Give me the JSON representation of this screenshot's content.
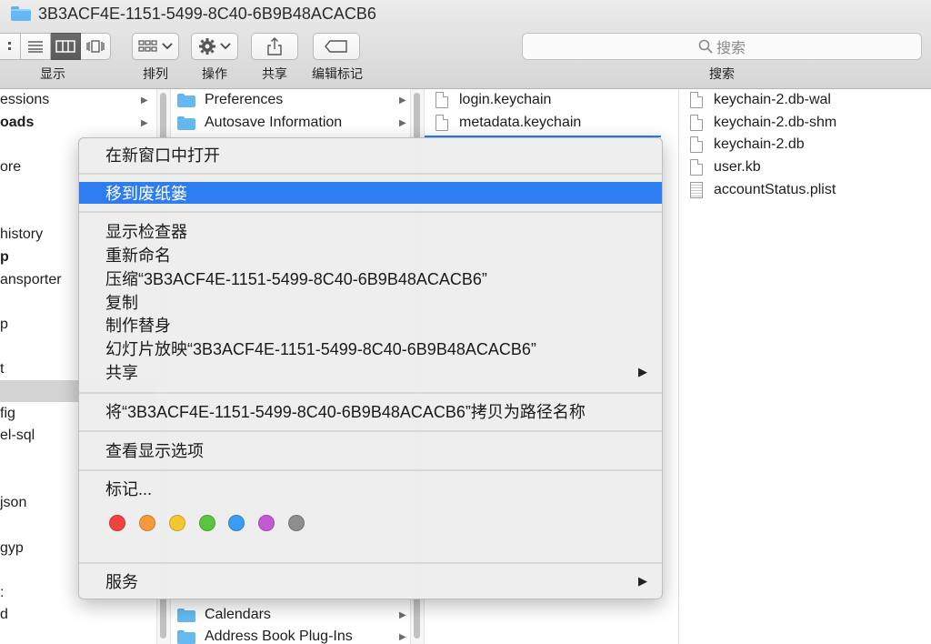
{
  "window": {
    "title": "3B3ACF4E-1151-5499-8C40-6B9B48ACACB6"
  },
  "toolbar": {
    "view_label": "显示",
    "arrange_label": "排列",
    "action_label": "操作",
    "share_label": "共享",
    "tags_label": "编辑标记",
    "search_label": "搜索",
    "search_placeholder": "搜索"
  },
  "columns": {
    "col1": [
      {
        "label": "essions",
        "arrow": true
      },
      {
        "label": "oads",
        "bold": true,
        "arrow": true
      },
      {
        "label": ""
      },
      {
        "label": "ore"
      },
      {
        "label": ""
      },
      {
        "label": ""
      },
      {
        "label": "history"
      },
      {
        "label": "p",
        "bold": true
      },
      {
        "label": "ansporter"
      },
      {
        "label": ""
      },
      {
        "label": "p"
      },
      {
        "label": ""
      },
      {
        "label": "t"
      },
      {
        "label": "",
        "selected": true
      },
      {
        "label": "fig"
      },
      {
        "label": "el-sql"
      },
      {
        "label": ""
      },
      {
        "label": ""
      },
      {
        "label": "json"
      },
      {
        "label": ""
      },
      {
        "label": "gyp"
      },
      {
        "label": ""
      },
      {
        "label": ":"
      },
      {
        "label": "d"
      }
    ],
    "col2_top": [
      "Preferences",
      "Autosave Information"
    ],
    "col2_bottom": [
      "Calendars",
      "Address Book Plug-Ins"
    ],
    "col3": [
      "login.keychain",
      "metadata.keychain"
    ],
    "col4": [
      "keychain-2.db-wal",
      "keychain-2.db-shm",
      "keychain-2.db",
      "user.kb",
      "accountStatus.plist"
    ]
  },
  "context_menu": {
    "open_new_window": "在新窗口中打开",
    "move_to_trash": "移到废纸篓",
    "show_inspector": "显示检查器",
    "rename": "重新命名",
    "compress": "压缩“3B3ACF4E-1151-5499-8C40-6B9B48ACACB6”",
    "copy": "复制",
    "make_alias": "制作替身",
    "slideshow": "幻灯片放映“3B3ACF4E-1151-5499-8C40-6B9B48ACACB6”",
    "share": "共享",
    "copy_as_path": "将“3B3ACF4E-1151-5499-8C40-6B9B48ACACB6”拷贝为路径名称",
    "view_options": "查看显示选项",
    "tags": "标记...",
    "services": "服务",
    "highlight_color": "#2d7df1",
    "tag_colors": [
      {
        "name": "red",
        "color": "#f2433d"
      },
      {
        "name": "orange",
        "color": "#f59a3b"
      },
      {
        "name": "yellow",
        "color": "#f4c630"
      },
      {
        "name": "green",
        "color": "#5ac53d"
      },
      {
        "name": "blue",
        "color": "#3a9cf3"
      },
      {
        "name": "purple",
        "color": "#c45ad3"
      },
      {
        "name": "gray",
        "color": "#8e8e8e"
      }
    ]
  }
}
